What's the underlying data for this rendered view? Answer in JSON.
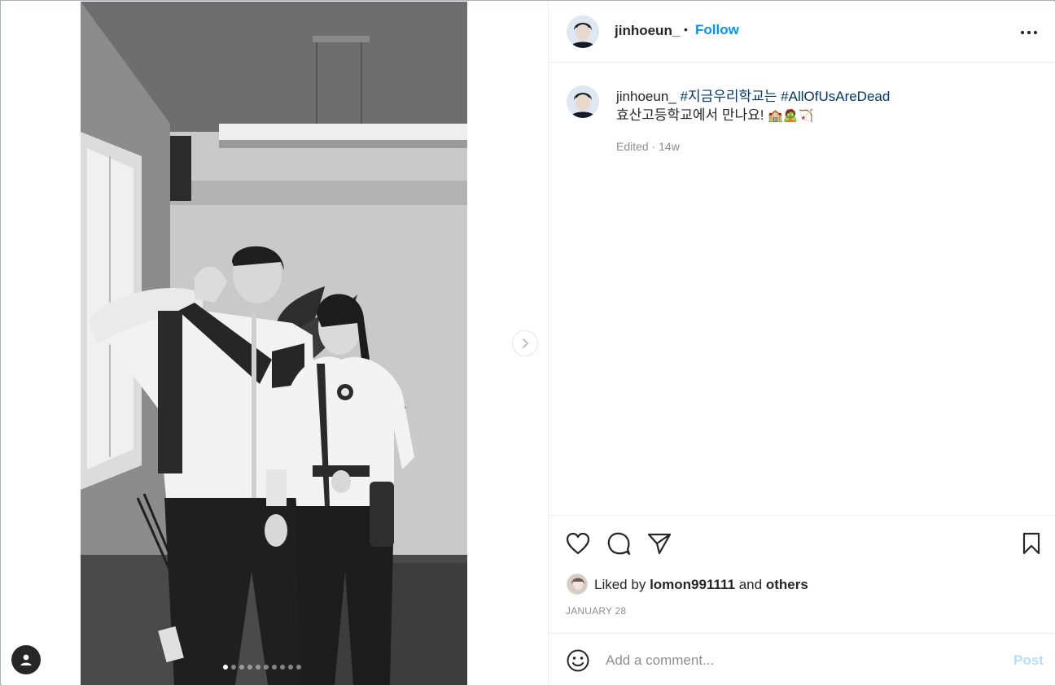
{
  "post": {
    "username": "jinhoeun_",
    "separator": "•",
    "follow_label": "Follow",
    "more_icon": "more-horizontal-icon",
    "caption": {
      "username": "jinhoeun_",
      "hashtag_1": "#지금우리학교는",
      "hashtag_2": "#AllOfUsAreDead",
      "text": "효산고등학교에서 만나요!",
      "emojis": "🏫🧟🏹"
    },
    "meta": "Edited · 14w",
    "carousel": {
      "total_slides": 10,
      "active_slide": 1
    }
  },
  "actions": {
    "like_icon": "heart-icon",
    "comment_icon": "comment-icon",
    "share_icon": "paper-plane-icon",
    "save_icon": "bookmark-icon"
  },
  "likes": {
    "prefix": "Liked by",
    "user": "lomon991111",
    "conjunction": "and",
    "others": "others"
  },
  "date": "JANUARY 28",
  "comment": {
    "placeholder": "Add a comment...",
    "post_label": "Post"
  },
  "colors": {
    "accent": "#0095f6",
    "hashtag": "#00376b",
    "muted": "#8e8e8e",
    "post_disabled": "#b2dffc"
  }
}
